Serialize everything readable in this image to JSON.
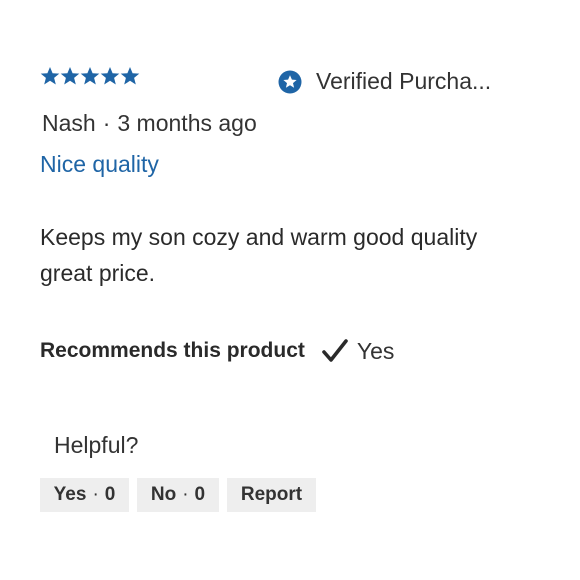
{
  "review": {
    "rating": 5,
    "rating_max": 5,
    "star_color": "#1f65a6",
    "verified_label": "Verified Purcha...",
    "author": "Nash",
    "date": "3 months ago",
    "title": "Nice quality",
    "title_color": "#1f65a6",
    "body": "Keeps my son cozy and warm good quality great price.",
    "recommends_label": "Recommends this product",
    "recommends_value": "Yes"
  },
  "helpful": {
    "label": "Helpful?",
    "yes_label": "Yes",
    "yes_count": "0",
    "no_label": "No",
    "no_count": "0",
    "report_label": "Report"
  },
  "icons": {
    "star": "star-icon",
    "verified": "verified-star-badge-icon",
    "check": "checkmark-icon"
  }
}
